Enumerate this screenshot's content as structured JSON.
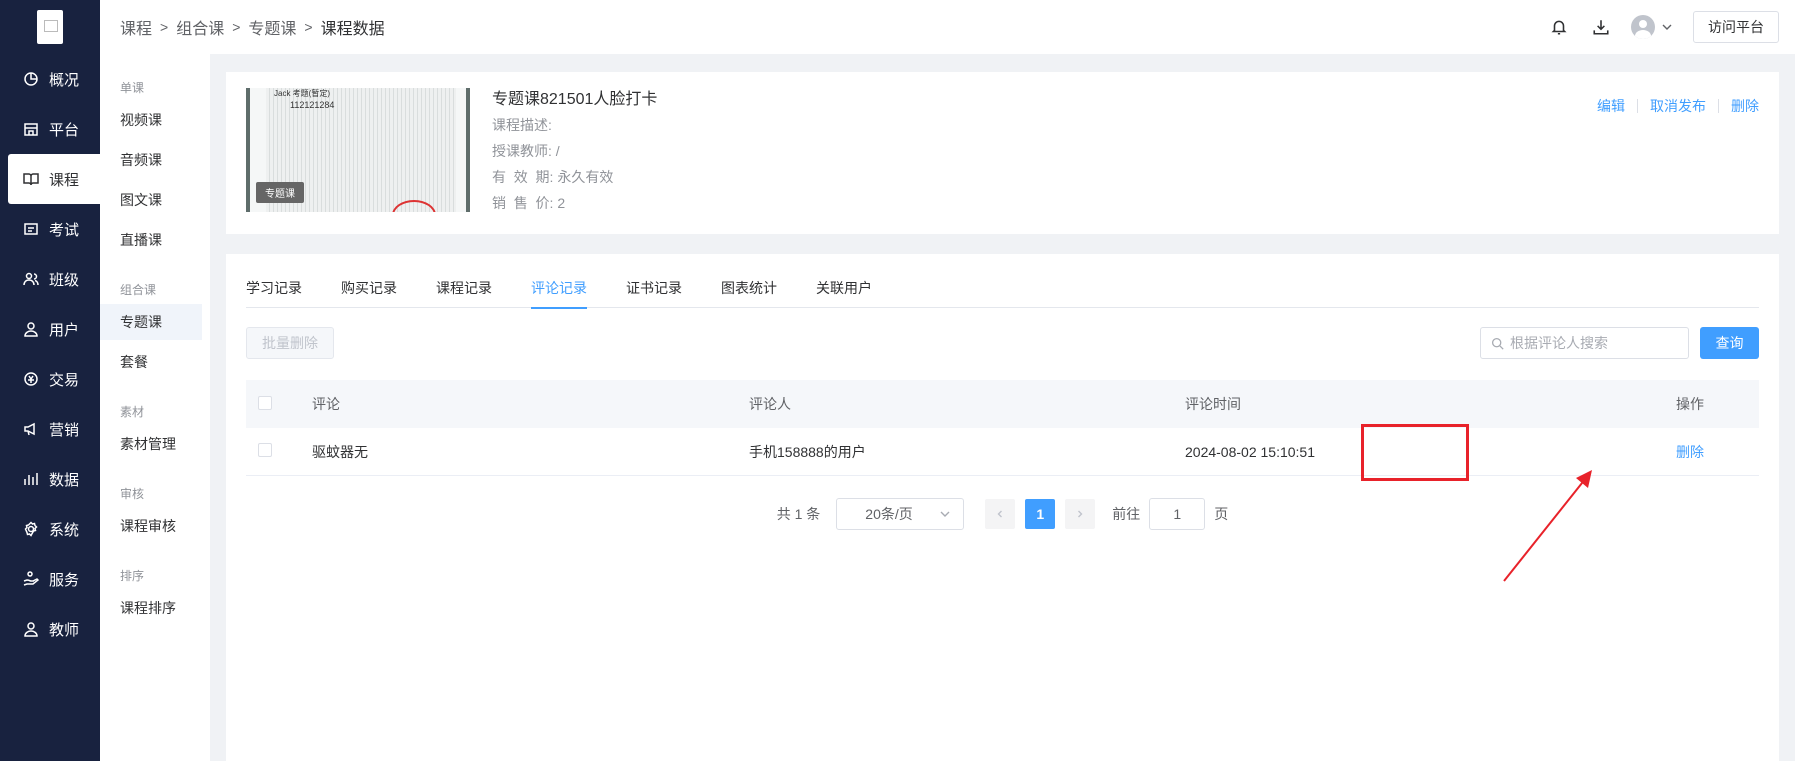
{
  "sidebar": {
    "items": [
      {
        "label": "概况",
        "icon": "pie-chart-icon"
      },
      {
        "label": "平台",
        "icon": "store-icon"
      },
      {
        "label": "课程",
        "icon": "book-icon",
        "active": true
      },
      {
        "label": "考试",
        "icon": "exam-icon"
      },
      {
        "label": "班级",
        "icon": "group-icon"
      },
      {
        "label": "用户",
        "icon": "user-icon"
      },
      {
        "label": "交易",
        "icon": "trade-icon"
      },
      {
        "label": "营销",
        "icon": "megaphone-icon"
      },
      {
        "label": "数据",
        "icon": "bar-chart-icon"
      },
      {
        "label": "系统",
        "icon": "gear-icon"
      },
      {
        "label": "服务",
        "icon": "service-icon"
      },
      {
        "label": "教师",
        "icon": "teacher-icon"
      }
    ]
  },
  "subnav": {
    "g1": "单课",
    "i_video": "视频课",
    "i_audio": "音频课",
    "i_text": "图文课",
    "i_live": "直播课",
    "g2": "组合课",
    "i_topic": "专题课",
    "i_bundle": "套餐",
    "g3": "素材",
    "i_material": "素材管理",
    "g4": "审核",
    "i_review": "课程审核",
    "g5": "排序",
    "i_sort": "课程排序"
  },
  "breadcrumb": [
    "课程",
    "组合课",
    "专题课",
    "课程数据"
  ],
  "header": {
    "visit_label": "访问平台"
  },
  "course": {
    "thumb_text1": "Jack 考题(暂定)",
    "thumb_text2": "112121284",
    "tag": "专题课",
    "title": "专题课821501人脸打卡",
    "desc": "课程描述:",
    "teacher": "授课教师: /",
    "validity": "有  效  期: 永久有效",
    "price": "销  售  价: 2",
    "actions": {
      "edit": "编辑",
      "unpublish": "取消发布",
      "delete": "删除"
    }
  },
  "tabs": [
    "学习记录",
    "购买记录",
    "课程记录",
    "评论记录",
    "证书记录",
    "图表统计",
    "关联用户"
  ],
  "active_tab": "评论记录",
  "toolbar": {
    "batch_delete": "批量删除",
    "search_placeholder": "根据评论人搜索",
    "query": "查询"
  },
  "table": {
    "headers": [
      "评论",
      "评论人",
      "评论时间",
      "操作"
    ],
    "rows": [
      {
        "comment": "驱蚊器无",
        "user": "手机158888的用户",
        "time": "2024-08-02 15:10:51",
        "action": "删除"
      }
    ]
  },
  "pagination": {
    "total": "共 1 条",
    "page_size": "20条/页",
    "current": "1",
    "goto_label": "前往",
    "goto_value": "1",
    "page_unit": "页"
  },
  "colors": {
    "accent": "#409eff",
    "sidebar": "#18223f",
    "highlight": "#e8222a"
  }
}
